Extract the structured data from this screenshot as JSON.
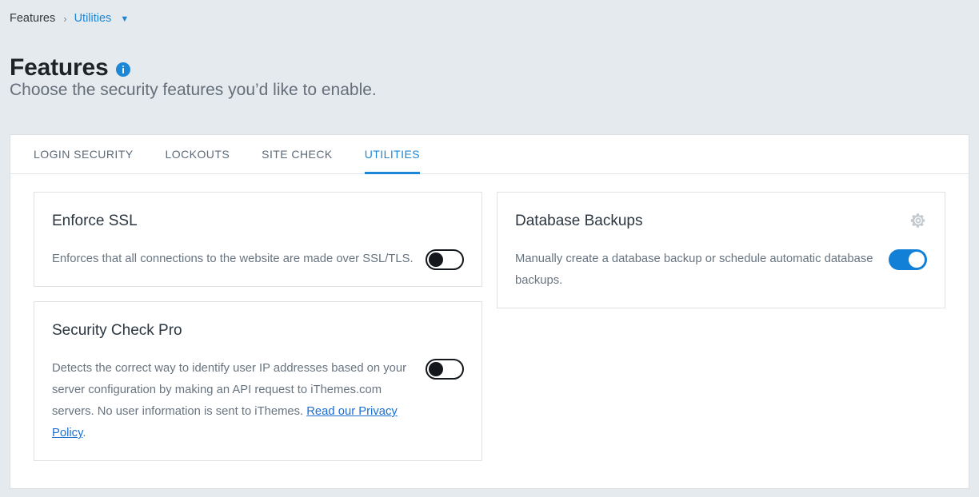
{
  "breadcrumb": {
    "root": "Features",
    "separator": "›",
    "current": "Utilities",
    "caret": "▼"
  },
  "header": {
    "title": "Features",
    "info_icon": "info-icon",
    "subtitle": "Choose the security features you’d like to enable."
  },
  "tabs": [
    {
      "label": "LOGIN SECURITY",
      "active": false
    },
    {
      "label": "LOCKOUTS",
      "active": false
    },
    {
      "label": "SITE CHECK",
      "active": false
    },
    {
      "label": "UTILITIES",
      "active": true
    }
  ],
  "cards": {
    "enforce_ssl": {
      "title": "Enforce SSL",
      "description": "Enforces that all connections to the website are made over SSL/TLS.",
      "toggle_state": "off"
    },
    "database_backups": {
      "title": "Database Backups",
      "description": "Manually create a database backup or schedule automatic database backups.",
      "toggle_state": "on",
      "settings_icon": "gear-icon"
    },
    "security_check_pro": {
      "title": "Security Check Pro",
      "description_before_link": "Detects the correct way to identify user IP addresses based on your server configuration by making an API request to iThemes.com servers. No user information is sent to iThemes. ",
      "link_text": "Read our Privacy Policy",
      "description_after_link": ".",
      "toggle_state": "off"
    }
  },
  "colors": {
    "accent": "#1b87d6",
    "toggle_on": "#1280d6",
    "toggle_off": "#14181c",
    "page_background": "#e5eaee",
    "panel_background": "#ffffff",
    "link": "#1b6fd4",
    "muted_text": "#687480"
  }
}
